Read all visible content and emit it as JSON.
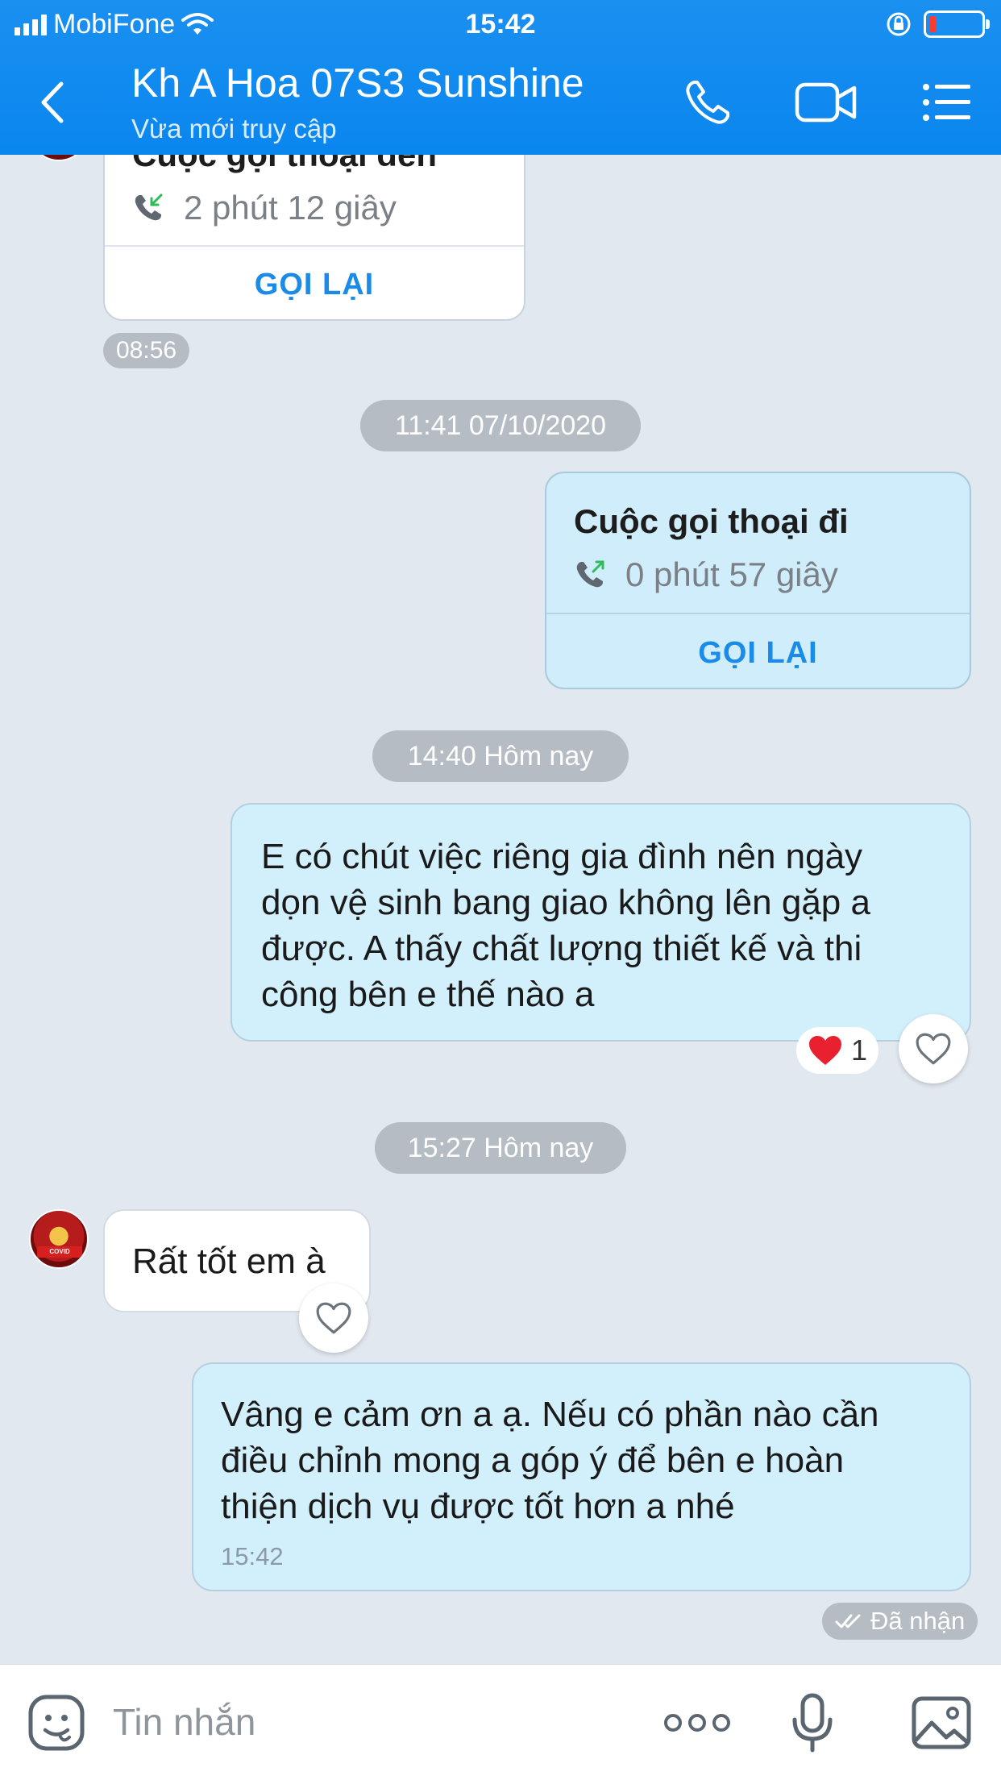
{
  "status_bar": {
    "carrier": "MobiFone",
    "time": "15:42"
  },
  "header": {
    "contact_name": "Kh A Hoa 07S3 Sunshine",
    "contact_status": "Vừa mới truy cập",
    "icons": [
      "back-arrow-icon",
      "phone-call-icon",
      "video-call-icon",
      "menu-list-icon"
    ]
  },
  "messages": {
    "incoming_call": {
      "title": "Cuộc gọi thoại đến",
      "duration": "2 phút 12 giây",
      "action": "GỌI LẠI",
      "time": "08:56"
    },
    "date_separator_1": "11:41 07/10/2020",
    "outgoing_call": {
      "title": "Cuộc gọi thoại đi",
      "duration": "0 phút 57 giây",
      "action": "GỌI LẠI"
    },
    "date_separator_2": "14:40 Hôm nay",
    "outgoing_text_1": {
      "lines": [
        "E có chút việc riêng gia đình nên ngày",
        "dọn vệ sinh bang giao không lên gặp a",
        "được. A thấy chất lượng thiết kế và thi",
        "công bên e thế nào a"
      ],
      "reaction_count": "1"
    },
    "date_separator_3": "15:27 Hôm nay",
    "incoming_text_1": {
      "text": "Rất tốt em à"
    },
    "outgoing_text_2": {
      "lines": [
        "Vâng e cảm ơn a ạ. Nếu có phần nào cần",
        "điều chỉnh mong a góp ý để bên e hoàn",
        "thiện dịch vụ được tốt hơn a nhé"
      ],
      "time": "15:42"
    },
    "read_receipt": "Đã nhận"
  },
  "input_bar": {
    "placeholder": "Tin nhắn",
    "icons": [
      "sticker-icon",
      "more-options-icon",
      "microphone-icon",
      "image-icon"
    ]
  },
  "colors": {
    "header_blue": "#1a90f0",
    "outgoing_bubble": "#d2effc",
    "incoming_bubble": "#ffffff",
    "accent_link": "#1a8be6",
    "reaction_heart": "#e8202f"
  }
}
